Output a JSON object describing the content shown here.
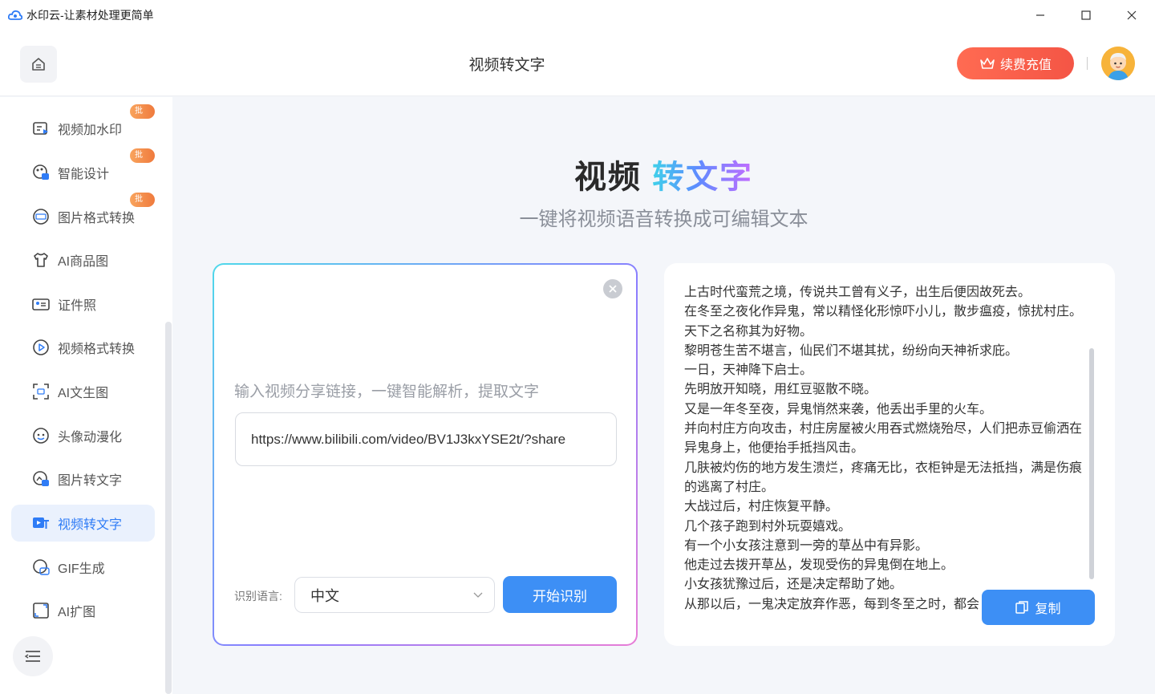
{
  "window": {
    "title": "水印云-让素材处理更简单",
    "controls": [
      "minimize-icon",
      "maximize-icon",
      "close-icon"
    ]
  },
  "header": {
    "title": "视频转文字",
    "recharge_label": "续费充值",
    "accent": "#f45545"
  },
  "sidebar": {
    "items": [
      {
        "label": "视频加水印",
        "icon": "video-watermark-icon",
        "badge": "批量"
      },
      {
        "label": "智能设计",
        "icon": "smart-design-icon",
        "badge": "批量"
      },
      {
        "label": "图片格式转换",
        "icon": "image-format-icon",
        "badge": "批量"
      },
      {
        "label": "AI商品图",
        "icon": "tshirt-icon",
        "badge": ""
      },
      {
        "label": "证件照",
        "icon": "id-card-icon",
        "badge": ""
      },
      {
        "label": "视频格式转换",
        "icon": "play-circle-icon",
        "badge": ""
      },
      {
        "label": "AI文生图",
        "icon": "ocr-scan-icon",
        "badge": ""
      },
      {
        "label": "头像动漫化",
        "icon": "face-icon",
        "badge": ""
      },
      {
        "label": "图片转文字",
        "icon": "image-text-icon",
        "badge": ""
      },
      {
        "label": "视频转文字",
        "icon": "video-text-icon",
        "badge": "",
        "active": true
      },
      {
        "label": "GIF生成",
        "icon": "gif-icon",
        "badge": ""
      },
      {
        "label": "AI扩图",
        "icon": "expand-image-icon",
        "badge": ""
      }
    ]
  },
  "hero": {
    "title_part1": "视频",
    "title_part2": "转文字",
    "subtitle": "一键将视频语音转换成可编辑文本"
  },
  "input_panel": {
    "prompt": "输入视频分享链接，一键智能解析，提取文字",
    "url_value": "https://www.bilibili.com/video/BV1J3kxYSE2t/?share",
    "language_label": "识别语言:",
    "language_value": "中文",
    "start_label": "开始识别"
  },
  "output_panel": {
    "lines": [
      "上古时代蛮荒之境，传说共工曾有义子，出生后便因故死去。",
      "在冬至之夜化作异鬼，常以精怪化形惊吓小儿，散步瘟疫，惊扰村庄。",
      "天下之名称其为好物。",
      "黎明苍生苦不堪言，仙民们不堪其扰，纷纷向天神祈求庇。",
      "一日，天神降下启士。",
      "先明放开知晓，用红豆驱散不晓。",
      "又是一年冬至夜，异鬼悄然来袭，他丢出手里的火车。",
      "并向村庄方向攻击，村庄房屋被火用吞式燃烧殆尽，人们把赤豆偷洒在异鬼身上，他便抬手抵挡风击。",
      "几肤被灼伤的地方发生溃烂，疼痛无比，衣柜钟是无法抵挡，满是伤痕的逃离了村庄。",
      "大战过后，村庄恢复平静。",
      "几个孩子跑到村外玩耍嬉戏。",
      "有一个小女孩注意到一旁的草丛中有异影。",
      "他走过去拨开草丛，发现受伤的异鬼倒在地上。",
      "小女孩犹豫过后，还是决定帮助了她。",
      "从那以后，一鬼决定放弃作恶，每到冬至之时，都会"
    ],
    "copy_label": "复制"
  }
}
